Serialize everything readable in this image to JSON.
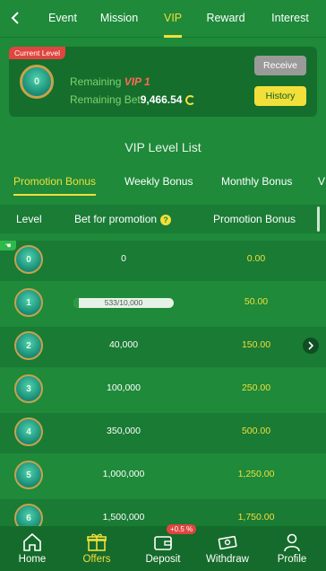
{
  "topnav": {
    "back_icon": "chevron-left-icon",
    "tabs": [
      {
        "label": "Event"
      },
      {
        "label": "Mission"
      },
      {
        "label": "VIP"
      },
      {
        "label": "Reward"
      },
      {
        "label": "Interest"
      }
    ],
    "active_tab": "VIP"
  },
  "level_card": {
    "tag": "Current Level",
    "level": "0",
    "remaining_label": "Remaining",
    "remaining_vip": "VIP 1",
    "remaining_bet_label": "Remaining Bet",
    "remaining_bet_value": "9,466.54",
    "receive_label": "Receive",
    "history_label": "History"
  },
  "list_title": "VIP Level List",
  "subtabs": [
    {
      "label": "Promotion Bonus"
    },
    {
      "label": "Weekly Bonus"
    },
    {
      "label": "Monthly Bonus"
    },
    {
      "label": "V"
    }
  ],
  "table": {
    "headers": {
      "level": "Level",
      "bet": "Bet for promotion",
      "bonus": "Promotion Bonus"
    },
    "rows": [
      {
        "level": "0",
        "bet": "0",
        "bonus": "0.00"
      },
      {
        "level": "1",
        "bet": "533/10,000",
        "bonus": "50.00",
        "progress": 0.0533
      },
      {
        "level": "2",
        "bet": "40,000",
        "bonus": "150.00"
      },
      {
        "level": "3",
        "bet": "100,000",
        "bonus": "250.00"
      },
      {
        "level": "4",
        "bet": "350,000",
        "bonus": "500.00"
      },
      {
        "level": "5",
        "bet": "1,000,000",
        "bonus": "1,250.00"
      },
      {
        "level": "6",
        "bet": "1,500,000",
        "bonus": "1,750.00"
      }
    ]
  },
  "bottom_nav": {
    "items": [
      {
        "label": "Home",
        "icon": "home-icon"
      },
      {
        "label": "Offers",
        "icon": "gift-icon"
      },
      {
        "label": "Deposit",
        "icon": "wallet-icon"
      },
      {
        "label": "Withdraw",
        "icon": "cash-icon"
      },
      {
        "label": "Profile",
        "icon": "user-icon"
      }
    ],
    "active": "Offers",
    "deposit_badge": "+0.5 %"
  },
  "colors": {
    "background": "#1e8a3a",
    "accent": "#f3df3a",
    "tag_red": "#e0453f"
  }
}
